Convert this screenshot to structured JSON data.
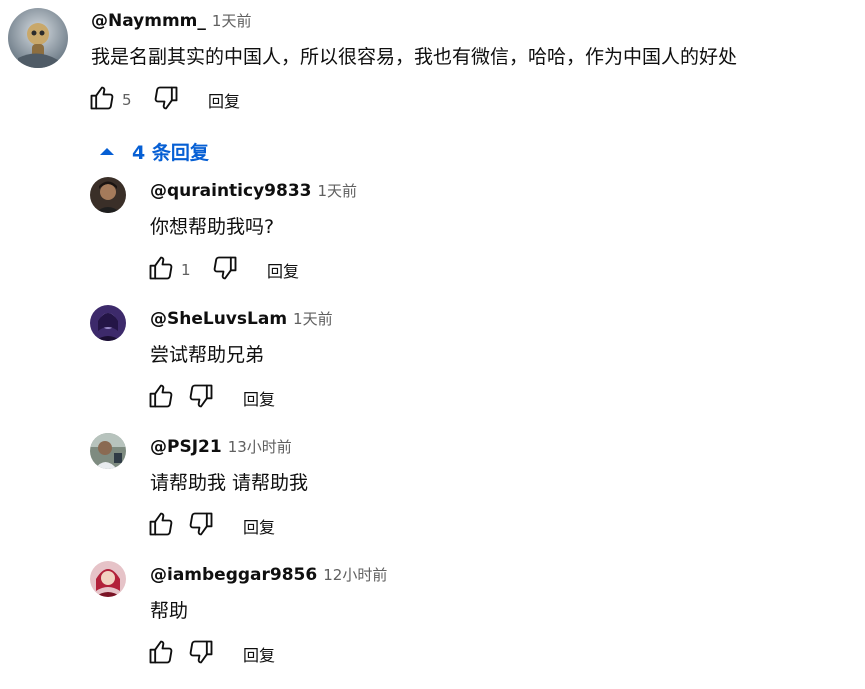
{
  "top_comment": {
    "author": "@Naymmm_",
    "time": "1天前",
    "text": "我是名副其实的中国人，所以很容易，我也有微信，哈哈，作为中国人的好处",
    "likes": "5",
    "reply_label": "回复"
  },
  "replies_toggle": {
    "label": "4 条回复"
  },
  "replies": [
    {
      "author": "@qurainticy9833",
      "time": "1天前",
      "text": "你想帮助我吗?",
      "likes": "1",
      "reply_label": "回复"
    },
    {
      "author": "@SheLuvsLam",
      "time": "1天前",
      "text": "尝试帮助兄弟",
      "likes": "",
      "reply_label": "回复"
    },
    {
      "author": "@PSJ21",
      "time": "13小时前",
      "text": "请帮助我 请帮助我",
      "likes": "",
      "reply_label": "回复"
    },
    {
      "author": "@iambeggar9856",
      "time": "12小时前",
      "text": "帮助",
      "likes": "",
      "reply_label": "回复"
    }
  ],
  "icons": {
    "like": "thumbs-up-icon",
    "dislike": "thumbs-down-icon",
    "toggle": "caret-up-icon"
  },
  "colors": {
    "link_blue": "#065fd4",
    "secondary_text": "#606060"
  }
}
